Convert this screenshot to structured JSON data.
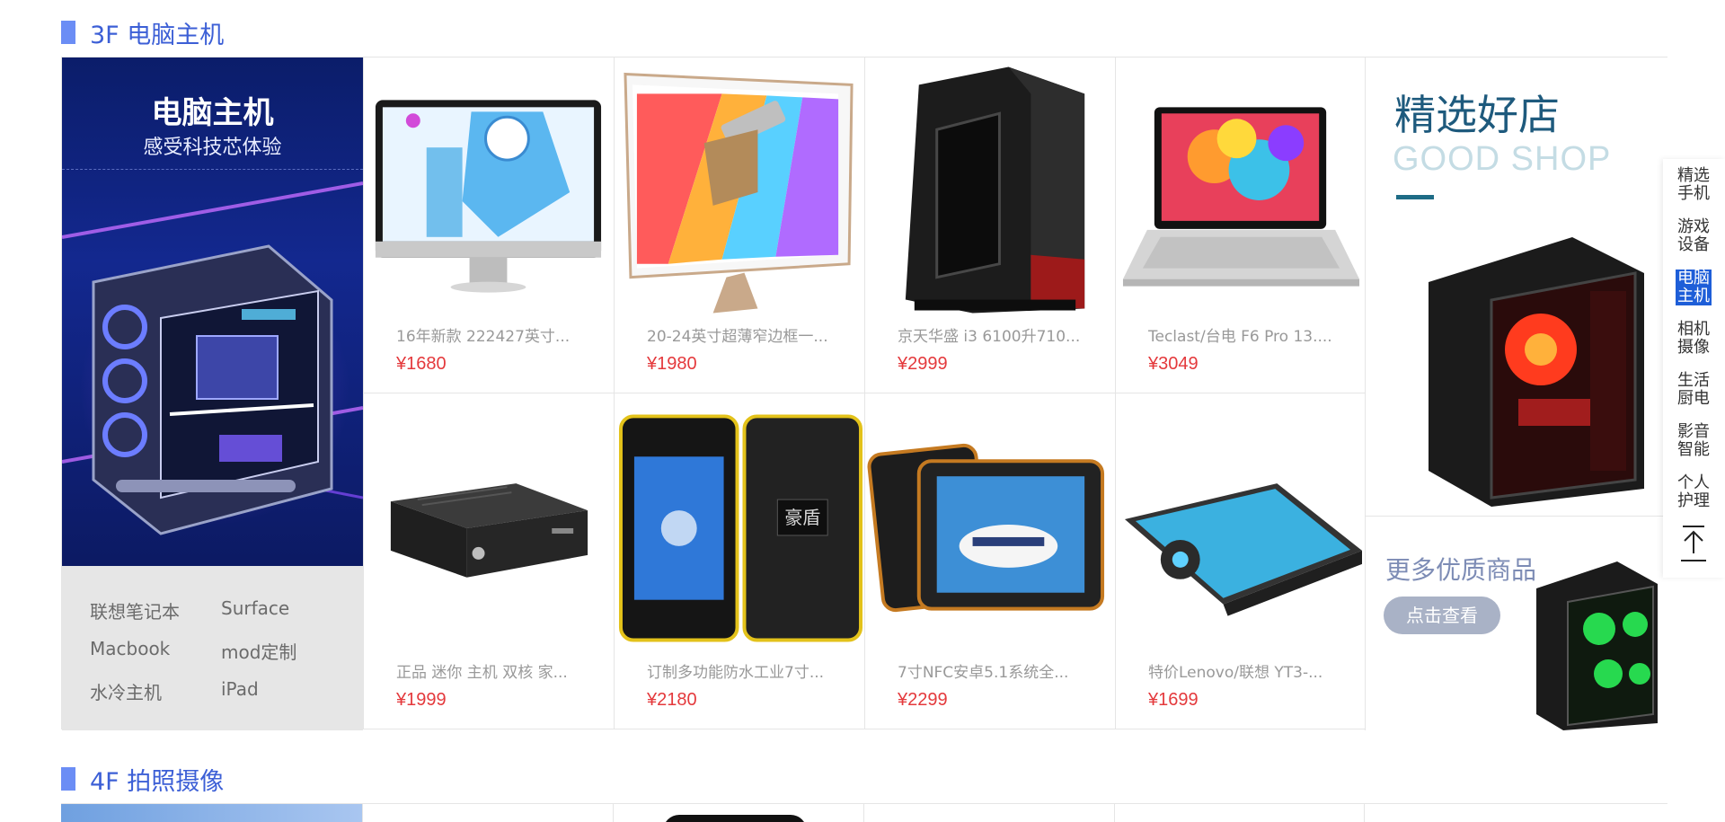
{
  "floors": {
    "f3": {
      "title": "3F 电脑主机"
    },
    "f4": {
      "title": "4F 拍照摄像"
    }
  },
  "promo": {
    "title": "电脑主机",
    "subtitle": "感受科技芯体验"
  },
  "quick_links": [
    "联想笔记本",
    "Surface",
    "Macbook",
    "mod定制",
    "水冷主机",
    "iPad"
  ],
  "products": [
    {
      "name": "16年新款 222427英寸...",
      "price": "¥1680"
    },
    {
      "name": "20-24英寸超薄窄边框一...",
      "price": "¥1980"
    },
    {
      "name": "京天华盛 i3 6100升710...",
      "price": "¥2999"
    },
    {
      "name": "Teclast/台电 F6 Pro 13....",
      "price": "¥3049"
    },
    {
      "name": "正品 迷你 主机 双核 家...",
      "price": "¥1999"
    },
    {
      "name": "订制多功能防水工业7寸...",
      "price": "¥2180"
    },
    {
      "name": "7寸NFC安卓5.1系统全...",
      "price": "¥2299"
    },
    {
      "name": "特价Lenovo/联想 YT3-...",
      "price": "¥1699"
    }
  ],
  "shop": {
    "title": "精选好店",
    "subtitle": "GOOD SHOP"
  },
  "more": {
    "title": "更多优质商品",
    "button": "点击查看"
  },
  "product_labels": {
    "tablet_brand": "豪盾"
  },
  "sidenav": {
    "items": [
      "精选手机",
      "游戏设备",
      "电脑主机",
      "相机摄像",
      "生活厨电",
      "影音智能",
      "个人护理"
    ],
    "active": "电脑主机"
  },
  "colors": {
    "accent": "#3c5fd6",
    "price": "#e4393c",
    "active_nav": "#1e5ed8"
  }
}
